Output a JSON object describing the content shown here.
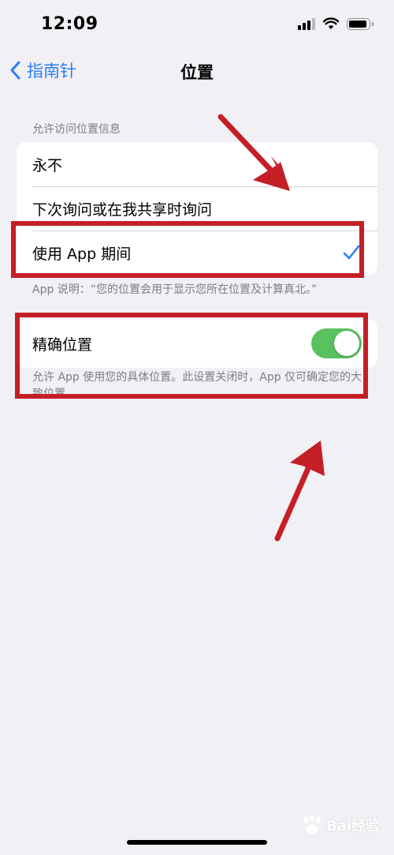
{
  "status_bar": {
    "time": "12:09"
  },
  "nav": {
    "back_label": "指南针",
    "title": "位置"
  },
  "location_access": {
    "header": "允许访问位置信息",
    "options": [
      {
        "label": "永不"
      },
      {
        "label": "下次询问或在我共享时询问"
      },
      {
        "label": "使用 App 期间",
        "selected": true
      }
    ],
    "footer": "App 说明：“您的位置会用于显示您所在位置及计算真北。”"
  },
  "precise_location": {
    "label": "精确位置",
    "enabled": true,
    "footer": "允许 App 使用您的具体位置。此设置关闭时，App 仅可确定您的大致位置。"
  },
  "watermark": {
    "text": "Bai经验"
  },
  "colors": {
    "accent": "#2c7df6",
    "toggle_on": "#5ac15f",
    "annotation": "#c41f26",
    "background": "#f1f0f5"
  }
}
